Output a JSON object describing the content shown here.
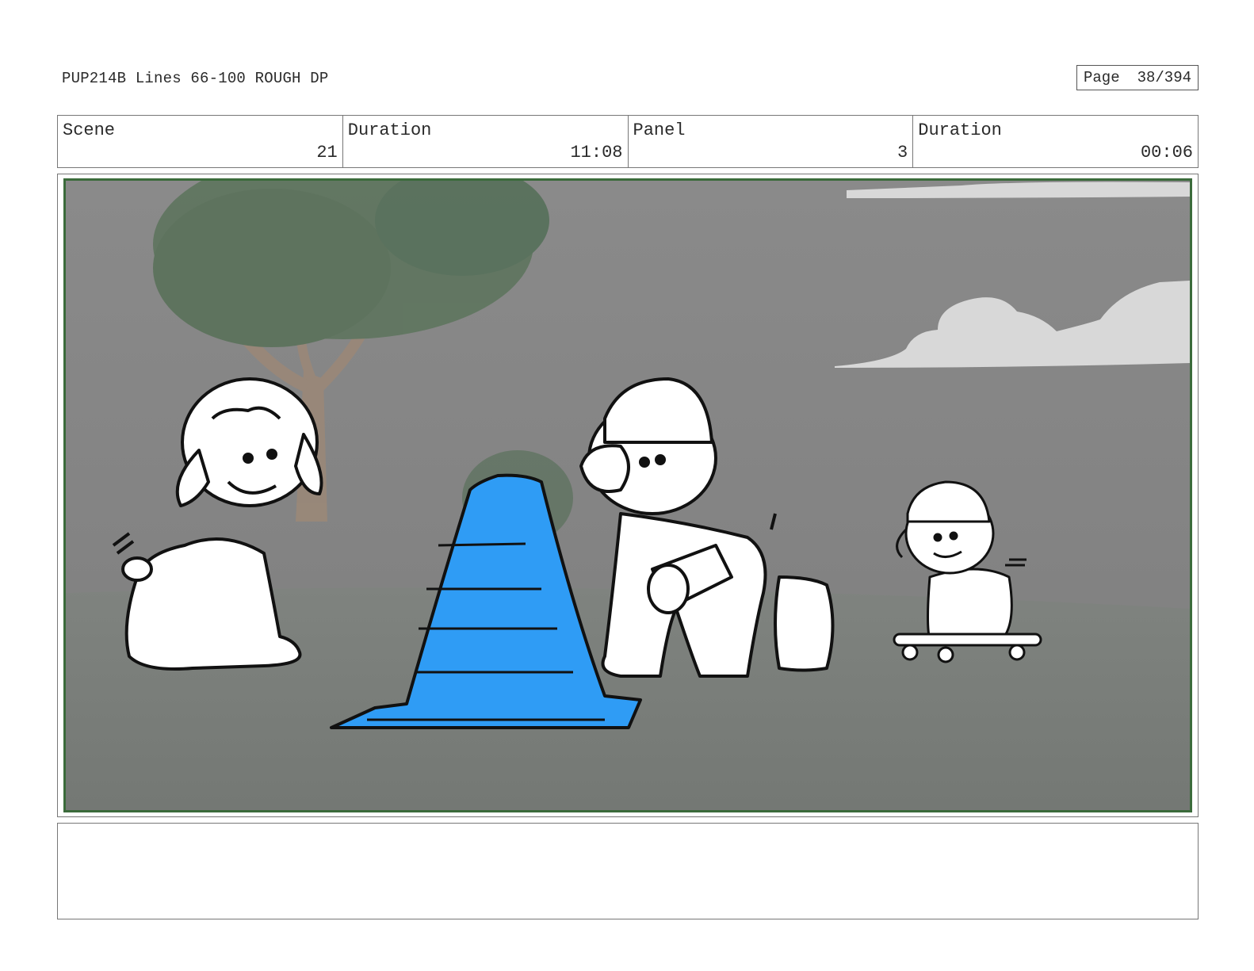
{
  "header": {
    "doc_title": "PUP214B Lines 66-100 ROUGH DP",
    "page_label": "Page",
    "page_number": "38/394"
  },
  "info": {
    "scene_label": "Scene",
    "scene_value": "21",
    "scene_duration_label": "Duration",
    "scene_duration_value": "11:08",
    "panel_label": "Panel",
    "panel_value": "3",
    "panel_duration_label": "Duration",
    "panel_duration_value": "00:06"
  },
  "panel_art": {
    "description_icon": "storyboard-panel-illustration",
    "colors": {
      "sky": "#858585",
      "ground": "#7b7f7b",
      "tree_foliage": "#5f7a5f",
      "tree_trunk": "#9a8a7a",
      "cloud": "#d8d8d8",
      "cone": "#2f9cf5",
      "frame_border": "#3b6b3b"
    }
  },
  "notes": {
    "text": ""
  }
}
